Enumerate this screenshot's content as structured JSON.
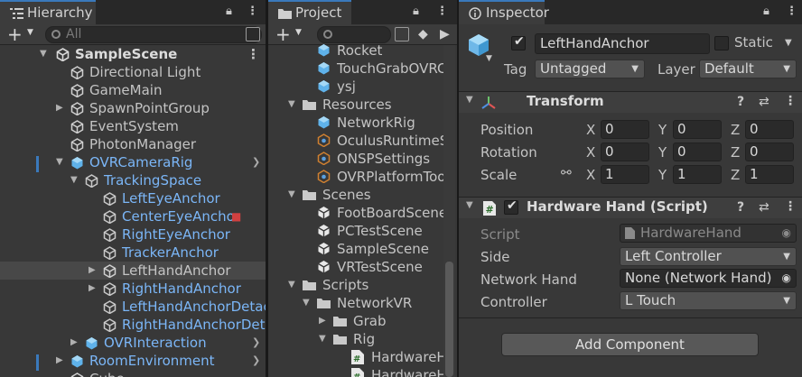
{
  "hierarchy": {
    "tab": "Hierarchy",
    "search_placeholder": "All",
    "scene": "SampleScene",
    "rows": [
      {
        "label": "Directional Light",
        "blue": false
      },
      {
        "label": "GameMain",
        "blue": false
      },
      {
        "label": "SpawnPointGroup",
        "blue": false
      },
      {
        "label": "EventSystem",
        "blue": false
      },
      {
        "label": "PhotonManager",
        "blue": false
      },
      {
        "label": "OVRCameraRig",
        "blue": true
      },
      {
        "label": "TrackingSpace",
        "blue": true
      },
      {
        "label": "LeftEyeAnchor",
        "blue": true
      },
      {
        "label": "CenterEyeAnchor",
        "blue": true
      },
      {
        "label": "RightEyeAnchor",
        "blue": true
      },
      {
        "label": "TrackerAnchor",
        "blue": true
      },
      {
        "label": "LeftHandAnchor",
        "blue": false
      },
      {
        "label": "RightHandAnchor",
        "blue": true
      },
      {
        "label": "LeftHandAnchorDetac",
        "blue": true
      },
      {
        "label": "RightHandAnchorDeta",
        "blue": true
      },
      {
        "label": "OVRInteraction",
        "blue": true
      },
      {
        "label": "RoomEnvironment",
        "blue": true
      },
      {
        "label": "Cube",
        "blue": false
      }
    ]
  },
  "project": {
    "tab": "Project",
    "rows": [
      {
        "label": "Rocket"
      },
      {
        "label": "TouchGrabOVRC"
      },
      {
        "label": "ysj"
      },
      {
        "label": "Resources"
      },
      {
        "label": "NetworkRig"
      },
      {
        "label": "OculusRuntimeS"
      },
      {
        "label": "ONSPSettings"
      },
      {
        "label": "OVRPlatformToo"
      },
      {
        "label": "Scenes"
      },
      {
        "label": "FootBoardScene"
      },
      {
        "label": "PCTestScene"
      },
      {
        "label": "SampleScene"
      },
      {
        "label": "VRTestScene"
      },
      {
        "label": "Scripts"
      },
      {
        "label": "NetworkVR"
      },
      {
        "label": "Grab"
      },
      {
        "label": "Rig"
      },
      {
        "label": "HardwareH"
      },
      {
        "label": "HardwareHa"
      }
    ]
  },
  "inspector": {
    "tab": "Inspector",
    "object_name": "LeftHandAnchor",
    "static_label": "Static",
    "tag_label": "Tag",
    "tag_value": "Untagged",
    "layer_label": "Layer",
    "layer_value": "Default",
    "transform": {
      "title": "Transform",
      "position_label": "Position",
      "rotation_label": "Rotation",
      "scale_label": "Scale",
      "x": "X",
      "y": "Y",
      "z": "Z",
      "position": [
        "0",
        "0",
        "0"
      ],
      "rotation": [
        "0",
        "0",
        "0"
      ],
      "scale": [
        "1",
        "1",
        "1"
      ]
    },
    "script": {
      "title": "Hardware Hand (Script)",
      "script_label": "Script",
      "script_value": "HardwareHand",
      "side_label": "Side",
      "side_value": "Left Controller",
      "network_label": "Network Hand",
      "network_value": "None (Network Hand)",
      "controller_label": "Controller",
      "controller_value": "L Touch"
    },
    "add_component": "Add Component"
  },
  "colors": {
    "accent_blue": "#7bb6f7",
    "panel_bg": "#383838",
    "tab_highlight": "#3a79bb"
  }
}
